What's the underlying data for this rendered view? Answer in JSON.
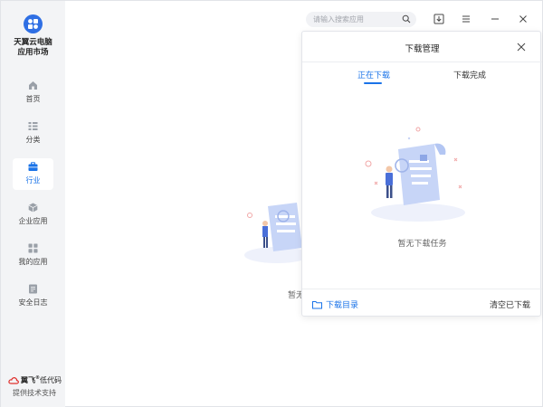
{
  "app": {
    "name_line1": "天翼云电脑",
    "name_line2": "应用市场",
    "brand_accent": "#2f6fe4"
  },
  "sidebar": {
    "items": [
      {
        "label": "首页",
        "icon": "home-icon",
        "active": false
      },
      {
        "label": "分类",
        "icon": "category-list-icon",
        "active": false
      },
      {
        "label": "行业",
        "icon": "briefcase-icon",
        "active": true
      },
      {
        "label": "企业应用",
        "icon": "cube-icon",
        "active": false
      },
      {
        "label": "我的应用",
        "icon": "grid-icon",
        "active": false
      },
      {
        "label": "安全日志",
        "icon": "document-icon",
        "active": false
      }
    ],
    "brand_text_a": "翼飞",
    "brand_text_b": "低代码",
    "brand_sub": "提供技术支持"
  },
  "topbar": {
    "search_placeholder": "请输入搜索应用"
  },
  "background": {
    "empty_text": "暂无"
  },
  "download_panel": {
    "title": "下载管理",
    "tabs": [
      {
        "label": "正在下载",
        "active": true
      },
      {
        "label": "下载完成",
        "active": false
      }
    ],
    "empty_text": "暂无下载任务",
    "download_dir_label": "下载目录",
    "clear_label": "清空已下载"
  },
  "colors": {
    "accent": "#1a73e8",
    "sidebar_bg": "#f3f4f6"
  }
}
